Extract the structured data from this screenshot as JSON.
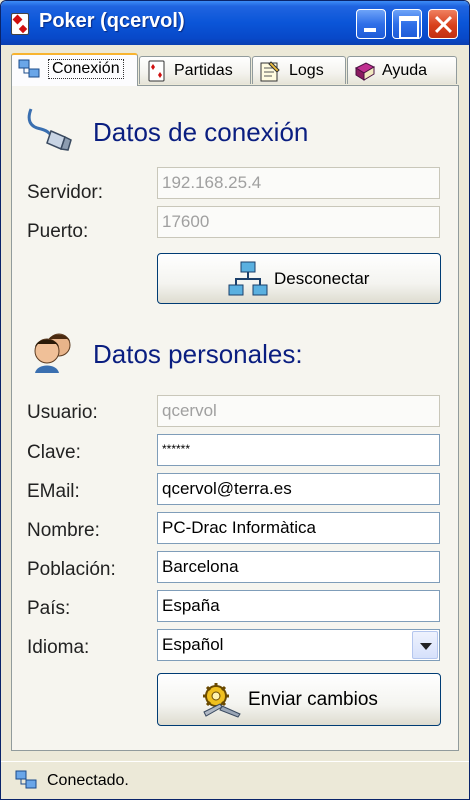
{
  "window": {
    "title": "Poker (qcervol)"
  },
  "tabs": [
    {
      "label": "Conexión",
      "icon": "network-icon",
      "active": true
    },
    {
      "label": "Partidas",
      "icon": "cards-icon",
      "active": false
    },
    {
      "label": "Logs",
      "icon": "notepad-icon",
      "active": false
    },
    {
      "label": "Ayuda",
      "icon": "help-book-icon",
      "active": false
    }
  ],
  "connection": {
    "title": "Datos de conexión",
    "server_label": "Servidor:",
    "server_value": "192.168.25.4",
    "port_label": "Puerto:",
    "port_value": "17600",
    "disconnect_label": "Desconectar"
  },
  "personal": {
    "title": "Datos personales:",
    "user_label": "Usuario:",
    "user_value": "qcervol",
    "password_label": "Clave:",
    "password_value": "******",
    "email_label": "EMail:",
    "email_value": "qcervol@terra.es",
    "name_label": "Nombre:",
    "name_value": "PC-Drac Informàtica",
    "city_label": "Población:",
    "city_value": "Barcelona",
    "country_label": "País:",
    "country_value": "España",
    "language_label": "Idioma:",
    "language_value": "Español",
    "submit_label": "Enviar cambios"
  },
  "status": {
    "text": "Conectado."
  },
  "colors": {
    "title_bar": "#0a55d8",
    "heading": "#0a1e80",
    "active_tab_accent": "#f8b430"
  }
}
